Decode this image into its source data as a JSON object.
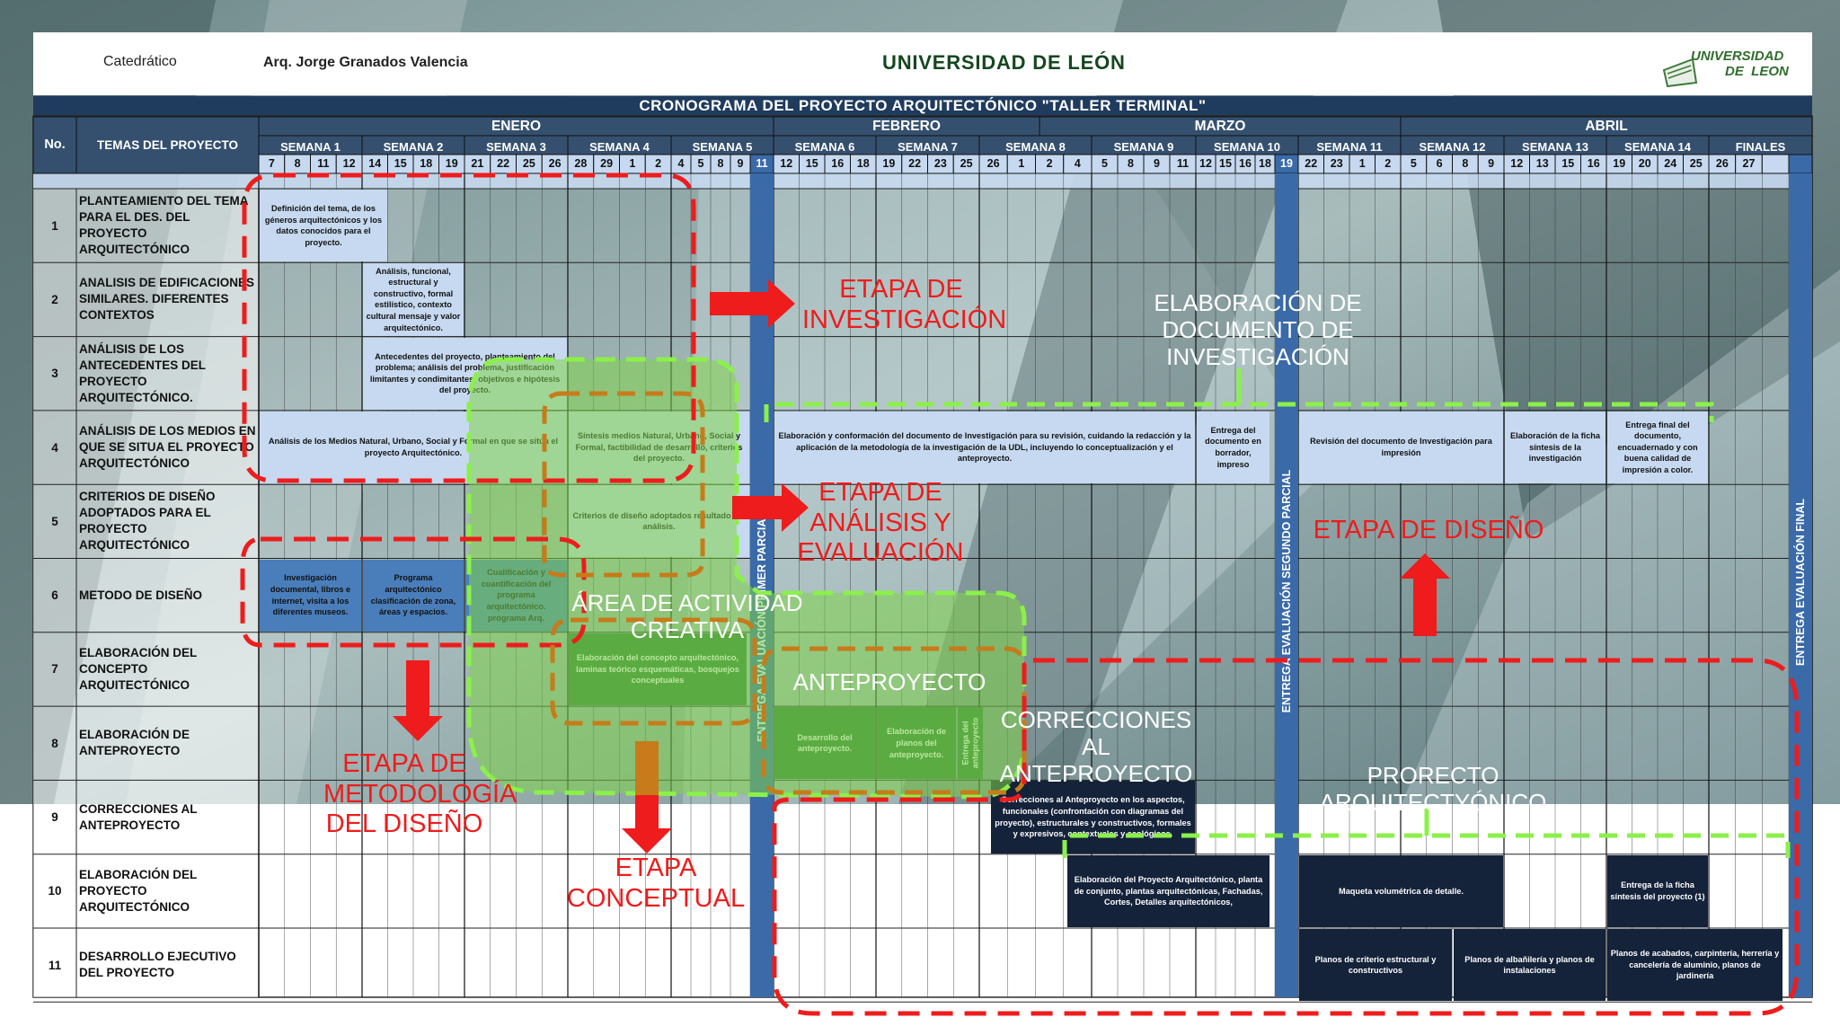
{
  "header": {
    "catedratico_label": "Catedrático",
    "catedratico_name": "Arq. Jorge Granados Valencia",
    "university": "UNIVERSIDAD DE LEÓN",
    "logo_text_1": "UNIVERSIDAD",
    "logo_text_2": "DE  LEON"
  },
  "title": "CRONOGRAMA DEL PROYECTO ARQUITECTÓNICO \"TALLER TERMINAL\"",
  "columns": {
    "no": "No.",
    "topics": "TEMAS DEL PROYECTO"
  },
  "months": [
    "ENERO",
    "FEBRERO",
    "MARZO",
    "ABRIL"
  ],
  "weeks": [
    "SEMANA 1",
    "SEMANA 2",
    "SEMANA 3",
    "SEMANA 4",
    "SEMANA 5",
    "SEMANA 6",
    "SEMANA 7",
    "SEMANA 8",
    "SEMANA 9",
    "SEMANA 10",
    "SEMANA 11",
    "SEMANA 12",
    "SEMANA 13",
    "SEMANA 14",
    "FINALES"
  ],
  "days": [
    "7",
    "8",
    "11",
    "12",
    "14",
    "15",
    "18",
    "19",
    "21",
    "22",
    "25",
    "26",
    "28",
    "29",
    "1",
    "2",
    "4",
    "5",
    "8",
    "9",
    "11",
    "12",
    "15",
    "16",
    "18",
    "19",
    "22",
    "23",
    "25",
    "26",
    "1",
    "2",
    "4",
    "5",
    "8",
    "9",
    "11",
    "12",
    "15",
    "16",
    "18",
    "19",
    "22",
    "23",
    "1",
    "2",
    "5",
    "6",
    "8",
    "9",
    "12",
    "13",
    "15",
    "16",
    "19",
    "20",
    "24",
    "25",
    "26",
    "27"
  ],
  "topics": [
    {
      "no": "1",
      "label": "PLANTEAMIENTO DEL TEMA PARA EL DES. DEL PROYECTO ARQUITECTÓNICO"
    },
    {
      "no": "2",
      "label": "ANALISIS DE EDIFICACIONES SIMILARES. DIFERENTES CONTEXTOS"
    },
    {
      "no": "3",
      "label": "ANÁLISIS DE LOS ANTECEDENTES DEL PROYECTO ARQUITECTÓNICO."
    },
    {
      "no": "4",
      "label": "ANÁLISIS DE LOS MEDIOS EN QUE SE SITUA EL PROYECTO ARQUITECTÓNICO"
    },
    {
      "no": "5",
      "label": "CRITERIOS DE DISEÑO ADOPTADOS PARA EL PROYECTO ARQUITECTÓNICO"
    },
    {
      "no": "6",
      "label": "METODO DE DISEÑO"
    },
    {
      "no": "7",
      "label": "ELABORACIÓN DEL CONCEPTO ARQUITECTÓNICO"
    },
    {
      "no": "8",
      "label": "ELABORACIÓN DE ANTEPROYECTO"
    },
    {
      "no": "9",
      "label": "CORRECCIONES AL ANTEPROYECTO"
    },
    {
      "no": "10",
      "label": "ELABORACIÓN DEL PROYECTO ARQUITECTÓNICO"
    },
    {
      "no": "11",
      "label": "DESARROLLO EJECUTIVO DEL PROYECTO"
    }
  ],
  "tasks": [
    {
      "text": "Definición del tema, de los géneros arquitectónicos y los datos conocidos para el proyecto."
    },
    {
      "text": "Análisis, funcional, estructural y constructivo, formal estilístico, contexto cultural mensaje y valor arquitectónico."
    },
    {
      "text": "Antecedentes del proyecto, planteamiento del problema; análisis del problema, justificación limitantes y condimitantes, objetivos e hipótesis del proyecto."
    },
    {
      "text": "Análisis de los Medios Natural, Urbano, Social y Formal en que se sitúa el proyecto Arquitectónico."
    },
    {
      "text": "Síntesis medios Natural, Urbano, Social y Formal, factibilidad de desarrollo, criterios del proyecto."
    },
    {
      "text": "Elaboración y conformación del documento de Investigación para su revisión, cuidando la redacción y la aplicación de la metodología de la investigación de la UDL, incluyendo lo conceptualización y el anteproyecto."
    },
    {
      "text": "Entrega del documento en borrador, impreso"
    },
    {
      "text": "Revisión del documento de Investigación para impresión"
    },
    {
      "text": "Elaboración de la ficha síntesis de la investigación"
    },
    {
      "text": "Entrega final del documento, encuadernado y con buena calidad de impresión a color."
    },
    {
      "text": "Criterios de diseño adoptados resultado del análisis."
    },
    {
      "text": "Investigación documental, libros e internet, visita a los diferentes museos."
    },
    {
      "text": "Programa arquitectónico clasificación de zona, áreas y espacios."
    },
    {
      "text": "Cualificación y cuantificación del programa arquitectónico. programa Arq."
    },
    {
      "text": "Elaboración del concepto arquitectónico, laminas teórico esquemáticas, bosquejos conceptuales"
    },
    {
      "text": "Desarrollo del anteproyecto."
    },
    {
      "text": "Elaboración de planos del anteproyecto."
    },
    {
      "text": "Entrega del anteproyecto"
    },
    {
      "text": "Correcciones al Anteproyecto en los aspectos, funcionales (confrontación con diagramas del proyecto), estructurales y constructivos, formales y expresivos, contextuales y ecológicos."
    },
    {
      "text": "Elaboración del Proyecto Arquitectónico, planta de conjunto, plantas arquitectónicas, Fachadas, Cortes, Detalles arquitectónicos,"
    },
    {
      "text": "Maqueta volumétrica de detalle."
    },
    {
      "text": "Entrega de la ficha síntesis del proyecto (1)"
    },
    {
      "text": "Planos de criterio estructural y constructivos"
    },
    {
      "text": "Planos de albañilería y planos de instalaciones"
    },
    {
      "text": "Planos de acabados, carpintería, herrería y cancelería de aluminio, planos de jardinería"
    }
  ],
  "evaluations": [
    "ENTREGA EVALUACIÓN PRIMER PARCIAL",
    "ENTREGA EVALUACIÓN SEGUNDO PARCIAL",
    "ENTREGA EVALUACIÓN FINAL"
  ],
  "overlays": {
    "etapa_investigacion": "ETAPA DE INVESTIGACIÓN",
    "elaboracion_documento": "ELABORACIÓN DE DOCUMENTO DE INVESTIGACIÓN",
    "etapa_analisis": "ETAPA DE ANÁLISIS Y EVALUACIÓN",
    "etapa_diseno": "ETAPA DE DISEÑO",
    "area_creativa": "ÁREA DE ACTIVIDAD CREATIVA",
    "anteproyecto": "ANTEPROYECTO",
    "correcciones": "CORRECCIONES AL ANTEPROYECTO",
    "proyecto": "PRORECTO ARQUITECTYÓNICO",
    "etapa_metodologia": "ETAPA DE METODOLOGÍA DEL DISEÑO",
    "etapa_conceptual": "ETAPA CONCEPTUAL"
  },
  "colors": {
    "dark_navy": "#1f3b5e",
    "header_blue": "#35506f",
    "light_blue_cell": "#c6d9f0",
    "medium_blue_cell": "#4a7ebb",
    "dark_cell": "#14223a",
    "eval_column": "#3a6aa8",
    "red_overlay": "#ee1c1c",
    "green_overlay": "#7fd44a",
    "orange_overlay": "#c77b1a"
  }
}
